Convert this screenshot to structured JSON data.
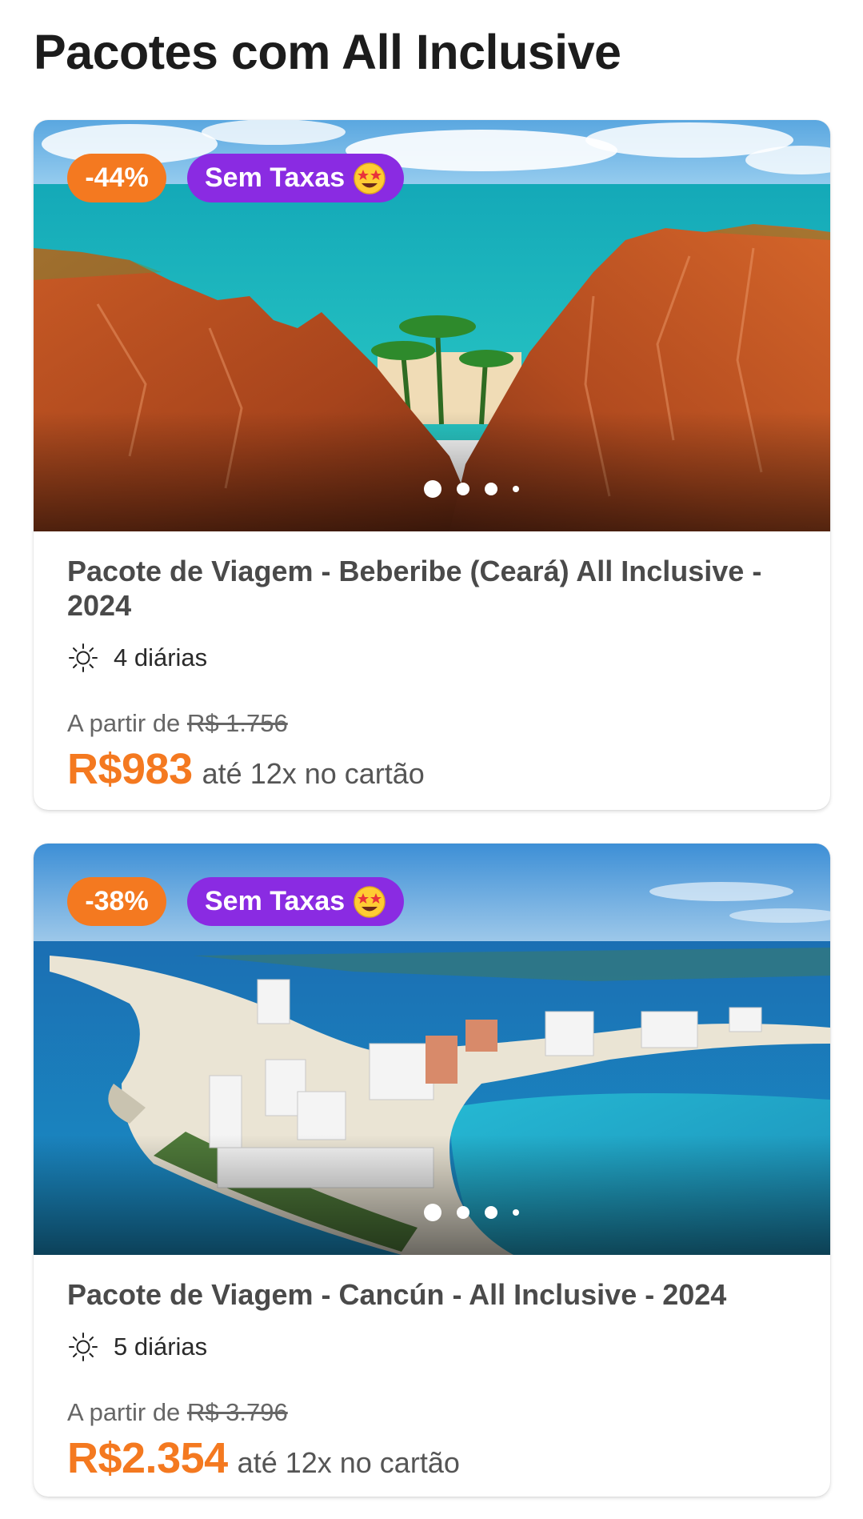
{
  "section": {
    "title": "Pacotes com All Inclusive"
  },
  "colors": {
    "discount": "#f47920",
    "fees": "#8a2be2",
    "price": "#f47920"
  },
  "packages": [
    {
      "discount": "-44%",
      "fees_label": "Sem Taxas",
      "fees_icon": "star-struck-emoji-icon",
      "title": "Pacote de Viagem - Beberibe (Ceará) All Inclusive - 2024",
      "nights_icon": "sun-icon",
      "nights": "4 diárias",
      "from_label": "A partir de",
      "old_price": "R$ 1.756",
      "price": "R$983",
      "installments": "até 12x no cartão",
      "carousel": {
        "slides": 4,
        "active": 1
      }
    },
    {
      "discount": "-38%",
      "fees_label": "Sem Taxas",
      "fees_icon": "star-struck-emoji-icon",
      "title": "Pacote de Viagem - Cancún - All Inclusive - 2024",
      "nights_icon": "sun-icon",
      "nights": "5 diárias",
      "from_label": "A partir de",
      "old_price": "R$ 3.796",
      "price": "R$2.354",
      "installments": "até 12x no cartão",
      "carousel": {
        "slides": 4,
        "active": 1
      }
    }
  ]
}
